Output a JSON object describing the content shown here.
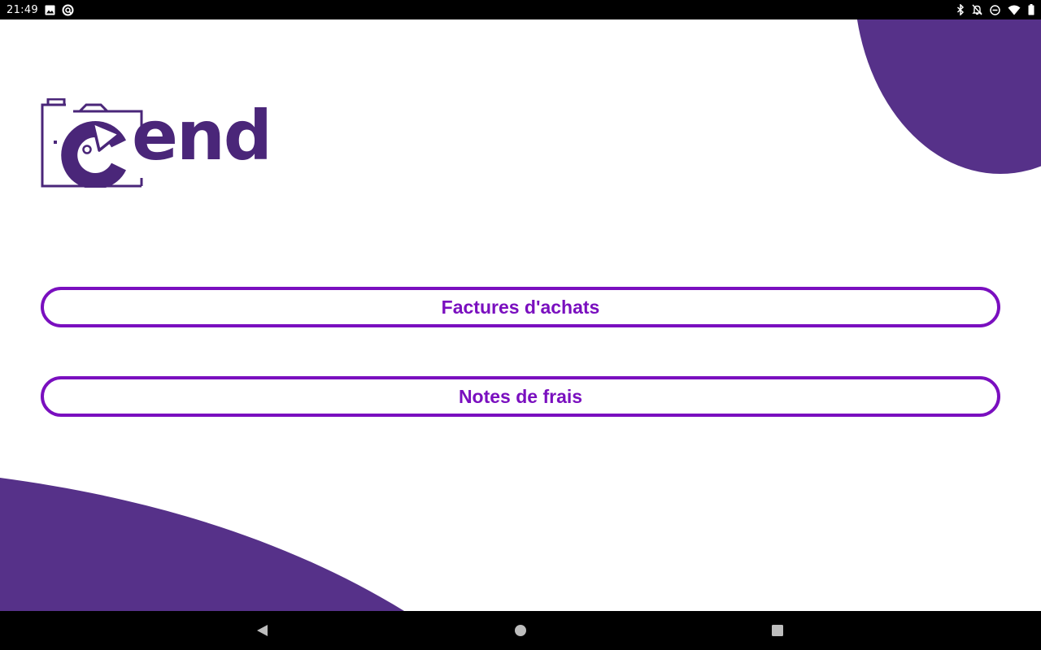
{
  "status_bar": {
    "time": "21:49",
    "left_icons": [
      "image-icon",
      "sync-icon"
    ],
    "right_icons": [
      "bluetooth-icon",
      "notifications-off-icon",
      "do-not-disturb-icon",
      "wifi-icon",
      "battery-icon"
    ]
  },
  "app": {
    "logo_text": "Cend",
    "logo_icon": "camera-icon",
    "buttons": [
      {
        "label": "Factures d'achats"
      },
      {
        "label": "Notes de frais"
      }
    ]
  },
  "nav_bar": {
    "icons": [
      "back-icon",
      "home-icon",
      "recents-icon"
    ]
  },
  "colors": {
    "brand_purple": "#563189",
    "logo_purple": "#4a2679",
    "button_accent": "#7a0fbf",
    "background": "#ffffff"
  }
}
